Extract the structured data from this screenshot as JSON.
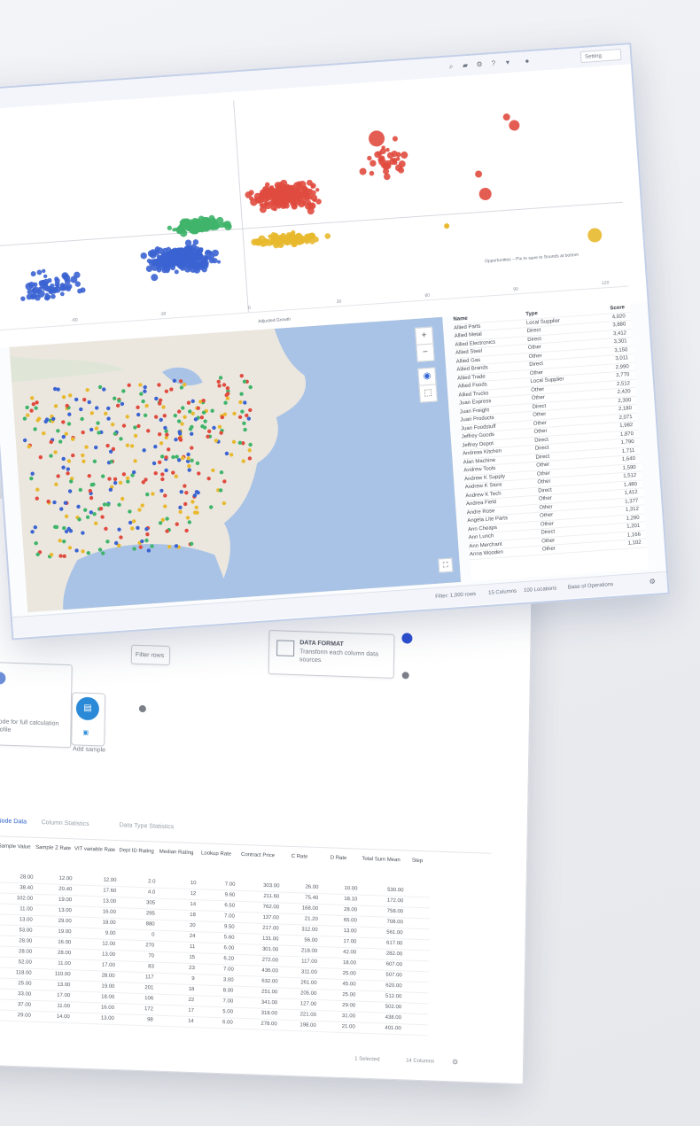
{
  "front_window": {
    "toolbar_select": "Setting",
    "scatter": {
      "legend_text": "Opportunities – Pin to save to Sounds at bottom",
      "x_axis_label": "Adjusted Growth",
      "x_ticks": [
        "-60",
        "-30",
        "0",
        "30",
        "60",
        "90",
        "120"
      ]
    },
    "table": {
      "headers": [
        "Name",
        "Type",
        "Score"
      ],
      "rows": [
        [
          "Allied Parts",
          "Local Supplier",
          "4,020"
        ],
        [
          "Allied Metal",
          "Direct",
          "3,880"
        ],
        [
          "Allied Electronics",
          "Direct",
          "3,412"
        ],
        [
          "Allied Steel",
          "Other",
          "3,301"
        ],
        [
          "Allied Gas",
          "Other",
          "3,150"
        ],
        [
          "Allied Brands",
          "Direct",
          "3,011"
        ],
        [
          "Allied Trade",
          "Other",
          "2,990"
        ],
        [
          "Allied Foods",
          "Local Supplier",
          "2,770"
        ],
        [
          "Allied Trucks",
          "Other",
          "2,512"
        ],
        [
          "Juan Express",
          "Other",
          "2,420"
        ],
        [
          "Juan Freight",
          "Direct",
          "2,300"
        ],
        [
          "Juan Products",
          "Other",
          "2,180"
        ],
        [
          "Juan Foodstuff",
          "Other",
          "2,071"
        ],
        [
          "Jeffrey Goods",
          "Other",
          "1,982"
        ],
        [
          "Jeffrey Depot",
          "Direct",
          "1,870"
        ],
        [
          "Andreas Kitchen",
          "Direct",
          "1,790"
        ],
        [
          "Alan Machine",
          "Direct",
          "1,711"
        ],
        [
          "Andrew Tools",
          "Other",
          "1,640"
        ],
        [
          "Andrew K Supply",
          "Other",
          "1,590"
        ],
        [
          "Andrew K Store",
          "Other",
          "1,512"
        ],
        [
          "Andrew K Tech",
          "Direct",
          "1,480"
        ],
        [
          "Andrea Field",
          "Other",
          "1,412"
        ],
        [
          "Andre Rose",
          "Other",
          "1,377"
        ],
        [
          "Angela Lite Parts",
          "Other",
          "1,312"
        ],
        [
          "Ann Cheaps",
          "Other",
          "1,290"
        ],
        [
          "Ann Lunch",
          "Direct",
          "1,201"
        ],
        [
          "Ann Merchant",
          "Other",
          "1,166"
        ],
        [
          "Anna Wooden",
          "Other",
          "1,102"
        ]
      ]
    },
    "footer": {
      "items": [
        "Filter: 1,000 rows",
        "15 Columns",
        "100 Locations",
        "Base of Operations"
      ]
    }
  },
  "back_window": {
    "nodes": {
      "left_node_text": "Node for full calculation profile",
      "left_node_sub": "Add sample",
      "middle_label": "Filter rows",
      "right_node_title": "DATA FORMAT",
      "right_node_text": "Transform each column data sources"
    },
    "tabs": [
      "Node Data",
      "Column Statistics",
      "Data Type Statistics"
    ],
    "grid": {
      "headers": [
        "Sample Value",
        "Sample Z Rate",
        "VIT variable Rate",
        "Dept ID Rating",
        "Median Rating",
        "Lookup Rate",
        "Contract Price",
        "C Rate",
        "D Rate",
        "Total Sum Mean",
        "Step"
      ],
      "rows": [
        [
          "28.00",
          "12.00",
          "12.00",
          "2.0",
          "10",
          "7.00",
          "303.00",
          "26.00",
          "10.00",
          "530.00",
          ""
        ],
        [
          "38.40",
          "20.40",
          "17.60",
          "4.0",
          "12",
          "9.60",
          "211.60",
          "75.40",
          "18.10",
          "172.00",
          ""
        ],
        [
          "102.00",
          "19.00",
          "13.00",
          "305",
          "14",
          "6.50",
          "762.00",
          "168.00",
          "28.00",
          "758.00",
          ""
        ],
        [
          "11.00",
          "13.00",
          "16.00",
          "295",
          "18",
          "7.00",
          "137.00",
          "21.20",
          "65.00",
          "708.00",
          ""
        ],
        [
          "13.00",
          "29.00",
          "18.00",
          "880",
          "20",
          "9.50",
          "217.00",
          "312.00",
          "13.00",
          "561.00",
          ""
        ],
        [
          "53.00",
          "19.00",
          "9.00",
          "0",
          "24",
          "5.60",
          "131.00",
          "56.00",
          "17.00",
          "617.00",
          ""
        ],
        [
          "28.00",
          "16.00",
          "12.00",
          "270",
          "11",
          "6.00",
          "301.00",
          "218.00",
          "42.00",
          "282.00",
          ""
        ],
        [
          "28.00",
          "28.00",
          "13.00",
          "70",
          "15",
          "6.20",
          "272.00",
          "117.00",
          "18.00",
          "607.00",
          ""
        ],
        [
          "52.00",
          "11.00",
          "17.00",
          "83",
          "23",
          "7.00",
          "436.00",
          "311.00",
          "25.00",
          "507.00",
          ""
        ],
        [
          "118.00",
          "110.00",
          "28.00",
          "117",
          "9",
          "3.00",
          "632.00",
          "261.00",
          "45.00",
          "620.00",
          ""
        ],
        [
          "25.00",
          "13.00",
          "19.00",
          "201",
          "18",
          "8.00",
          "251.00",
          "205.00",
          "25.00",
          "512.00",
          ""
        ],
        [
          "33.00",
          "17.00",
          "18.00",
          "106",
          "22",
          "7.00",
          "341.00",
          "127.00",
          "29.00",
          "502.00",
          ""
        ],
        [
          "37.00",
          "11.00",
          "16.00",
          "172",
          "17",
          "5.00",
          "318.00",
          "221.00",
          "31.00",
          "438.00",
          ""
        ],
        [
          "29.00",
          "14.00",
          "13.00",
          "98",
          "14",
          "6.00",
          "278.00",
          "198.00",
          "21.00",
          "401.00",
          ""
        ]
      ]
    },
    "status": [
      "1 Selected",
      "14 Columns"
    ]
  },
  "colors": {
    "blue": "#3b63d1",
    "green": "#3fb46a",
    "red": "#e04b3f",
    "yellow": "#e8b92e",
    "map_water": "#a9c3e6",
    "map_land": "#ebe7df"
  },
  "chart_data": {
    "type": "scatter",
    "xlabel": "Adjusted Growth",
    "x_ticks": [
      -60,
      -30,
      0,
      30,
      60,
      90,
      120
    ],
    "legend": "Opportunities – Pin to save to Sounds at bottom",
    "quadrant_groups": [
      {
        "color": "blue",
        "region": "x<0, lower"
      },
      {
        "color": "green",
        "region": "x<0, upper"
      },
      {
        "color": "red",
        "region": "x>0, upper"
      },
      {
        "color": "yellow",
        "region": "x>0, lower"
      }
    ]
  }
}
